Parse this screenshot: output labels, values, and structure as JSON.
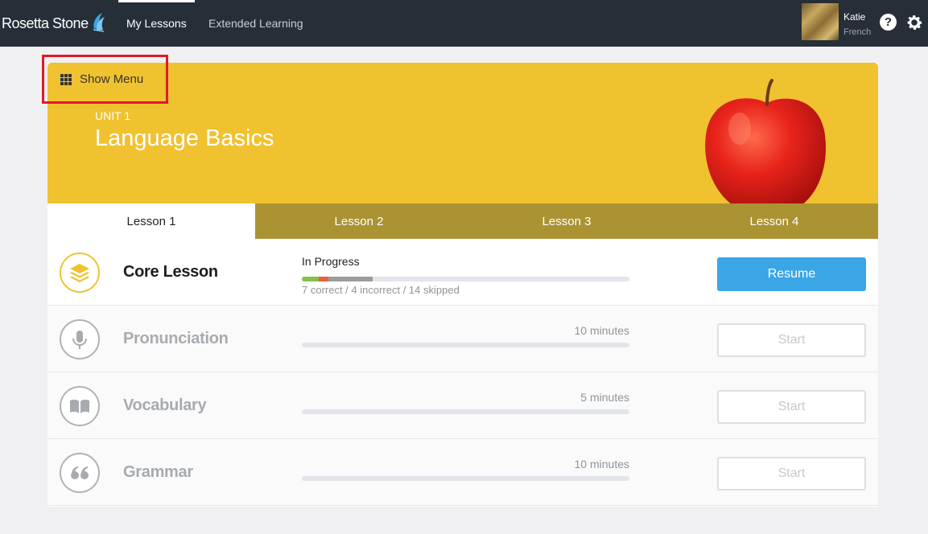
{
  "topbar": {
    "brand": "Rosetta Stone",
    "tabs": [
      {
        "label": "My Lessons",
        "active": true
      },
      {
        "label": "Extended Learning",
        "active": false
      }
    ],
    "user": {
      "name": "Katie",
      "language": "French"
    },
    "help_glyph": "?",
    "icons": [
      "rosetta-stone-logo-icon",
      "help-icon",
      "gear-icon"
    ]
  },
  "hero": {
    "show_menu_label": "Show Menu",
    "unit_label": "UNIT 1",
    "unit_title": "Language Basics",
    "colors": {
      "accent": "#f0c22f",
      "tab_bar": "#ab9334"
    }
  },
  "lesson_tabs": [
    {
      "label": "Lesson 1",
      "active": true
    },
    {
      "label": "Lesson 2",
      "active": false
    },
    {
      "label": "Lesson 3",
      "active": false
    },
    {
      "label": "Lesson 4",
      "active": false
    }
  ],
  "activities": [
    {
      "title": "Core Lesson",
      "icon": "layers-icon",
      "status": "In Progress",
      "progress": {
        "correct": 7,
        "incorrect": 4,
        "skipped": 14
      },
      "stats_text": "7 correct / 4 incorrect / 14 skipped",
      "button": "Resume",
      "enabled": true
    },
    {
      "title": "Pronunciation",
      "icon": "microphone-icon",
      "duration": "10 minutes",
      "button": "Start",
      "enabled": false
    },
    {
      "title": "Vocabulary",
      "icon": "book-icon",
      "duration": "5 minutes",
      "button": "Start",
      "enabled": false
    },
    {
      "title": "Grammar",
      "icon": "quote-icon",
      "duration": "10 minutes",
      "button": "Start",
      "enabled": false
    }
  ],
  "colors": {
    "primary_button": "#3aa6e6",
    "correct": "#86c04b",
    "incorrect": "#e8603c",
    "skipped": "#9c9c9c",
    "highlight": "#e3182b"
  }
}
